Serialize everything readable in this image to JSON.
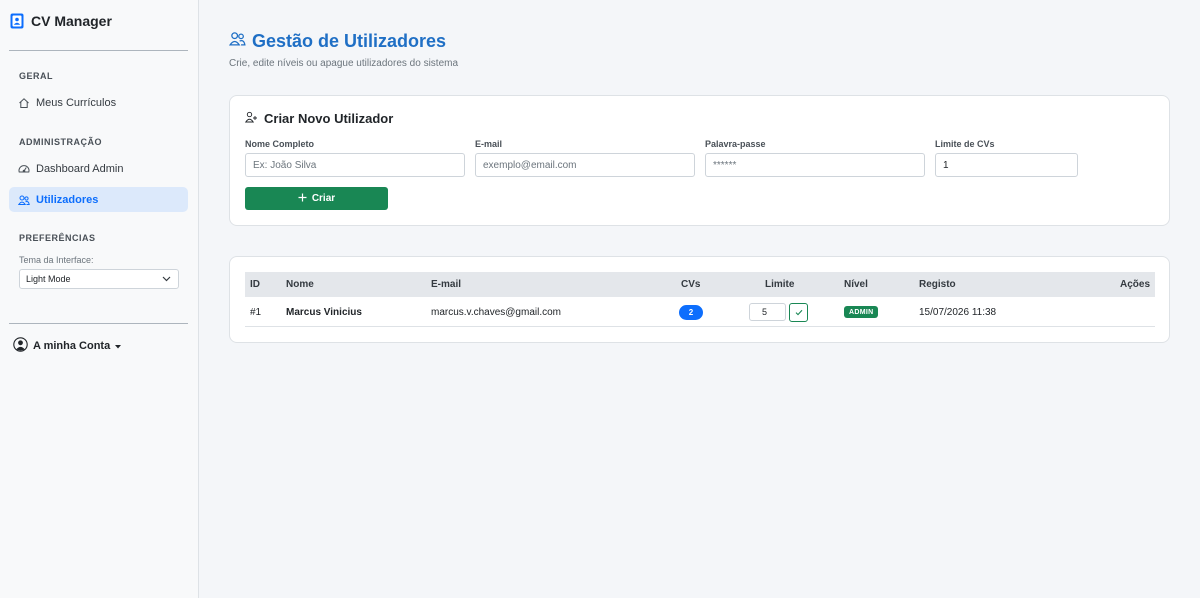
{
  "app": {
    "brand": "CV Manager"
  },
  "sidebar": {
    "sections": [
      {
        "label": "GERAL"
      },
      {
        "label": "ADMINISTRAÇÃO"
      },
      {
        "label": "PREFERÊNCIAS"
      }
    ],
    "items": [
      {
        "label": "Meus Currículos",
        "icon": "home-icon"
      },
      {
        "label": "Dashboard Admin",
        "icon": "speedometer-icon"
      },
      {
        "label": "Utilizadores",
        "icon": "people-icon",
        "active": true
      }
    ],
    "theme": {
      "label": "Tema da Interface:",
      "selected": "Light Mode"
    },
    "account": {
      "label": "A minha Conta",
      "icon": "person-circle-icon"
    }
  },
  "page": {
    "title": "Gestão de Utilizadores",
    "subtitle": "Crie, edite níveis ou apague utilizadores do sistema"
  },
  "create_form": {
    "title": "Criar Novo Utilizador",
    "fields": [
      {
        "label": "Nome Completo",
        "placeholder": "Ex: João Silva",
        "value": ""
      },
      {
        "label": "E-mail",
        "placeholder": "exemplo@email.com",
        "value": ""
      },
      {
        "label": "Palavra-passe",
        "placeholder": "******",
        "value": ""
      },
      {
        "label": "Limite de CVs",
        "placeholder": "",
        "value": "1"
      }
    ],
    "submit_label": "Criar"
  },
  "users_table": {
    "columns": [
      "ID",
      "Nome",
      "E-mail",
      "CVs",
      "Limite",
      "Nível",
      "Registo",
      "Ações"
    ],
    "rows": [
      {
        "id": "#1",
        "name": "Marcus Vinicius",
        "email": "marcus.v.chaves@gmail.com",
        "cvs": "2",
        "limit": "5",
        "level": "ADMIN",
        "registered": "15/07/2026 11:38"
      }
    ]
  },
  "colors": {
    "primary": "#0d6efd",
    "title_blue": "#1f6fc5",
    "success": "#198754",
    "active_bg": "#dce9fb"
  }
}
